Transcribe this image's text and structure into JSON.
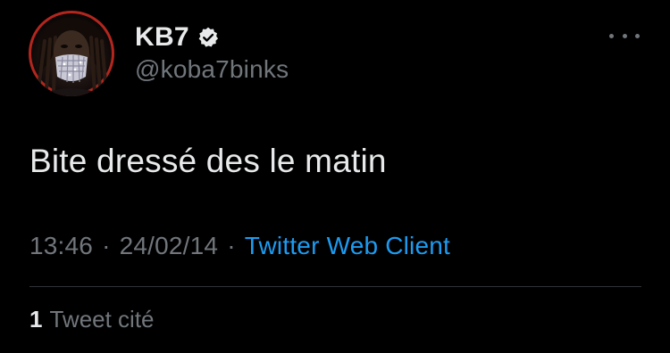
{
  "author": {
    "display_name": "KB7",
    "handle": "@koba7binks",
    "verified": true,
    "avatar": "profile-photo"
  },
  "tweet": {
    "text": "Bite dressé des le matin",
    "time": "13:46",
    "date": "24/02/14",
    "separator": "·",
    "client": "Twitter Web Client"
  },
  "stats": {
    "quote_count": "1",
    "quote_label": "Tweet cité"
  },
  "icons": {
    "verified": "verified-badge-icon",
    "more": "more-options-icon"
  },
  "colors": {
    "background": "#000000",
    "primary_text": "#e7e9ea",
    "secondary_text": "#71767b",
    "accent": "#1d9bf0",
    "avatar_ring": "#b3261e"
  }
}
